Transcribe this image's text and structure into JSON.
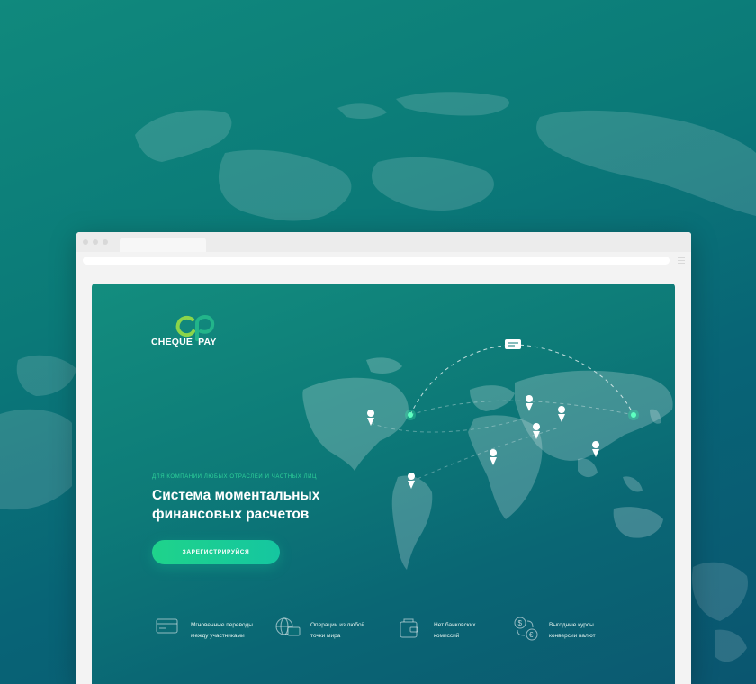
{
  "site": {
    "logo": {
      "brand_left": "CHEQUE",
      "brand_right": "PAY",
      "monogram": "CP"
    },
    "hero": {
      "eyebrow": "ДЛЯ КОМПАНИЙ ЛЮБЫХ ОТРАСЛЕЙ И ЧАСТНЫХ ЛИЦ",
      "title_line1": "Система моментальных",
      "title_line2": "финансовых расчетов",
      "cta_label": "ЗАРЕГИСТРИРУЙСЯ"
    },
    "features": [
      {
        "icon": "card-icon",
        "line1": "Мгновенные переводы",
        "line2": "между участниками"
      },
      {
        "icon": "globe-card-icon",
        "line1": "Операции из любой",
        "line2": "точки мира"
      },
      {
        "icon": "wallet-icon",
        "line1": "Нет банковских",
        "line2": "комиссий"
      },
      {
        "icon": "currency-exchange-icon",
        "line1": "Выгодные курсы",
        "line2": "конверсии валют"
      }
    ]
  },
  "colors": {
    "accent_green": "#1fd38b",
    "eyebrow_green": "#2fd39a",
    "background_teal": "#0b7a78"
  }
}
